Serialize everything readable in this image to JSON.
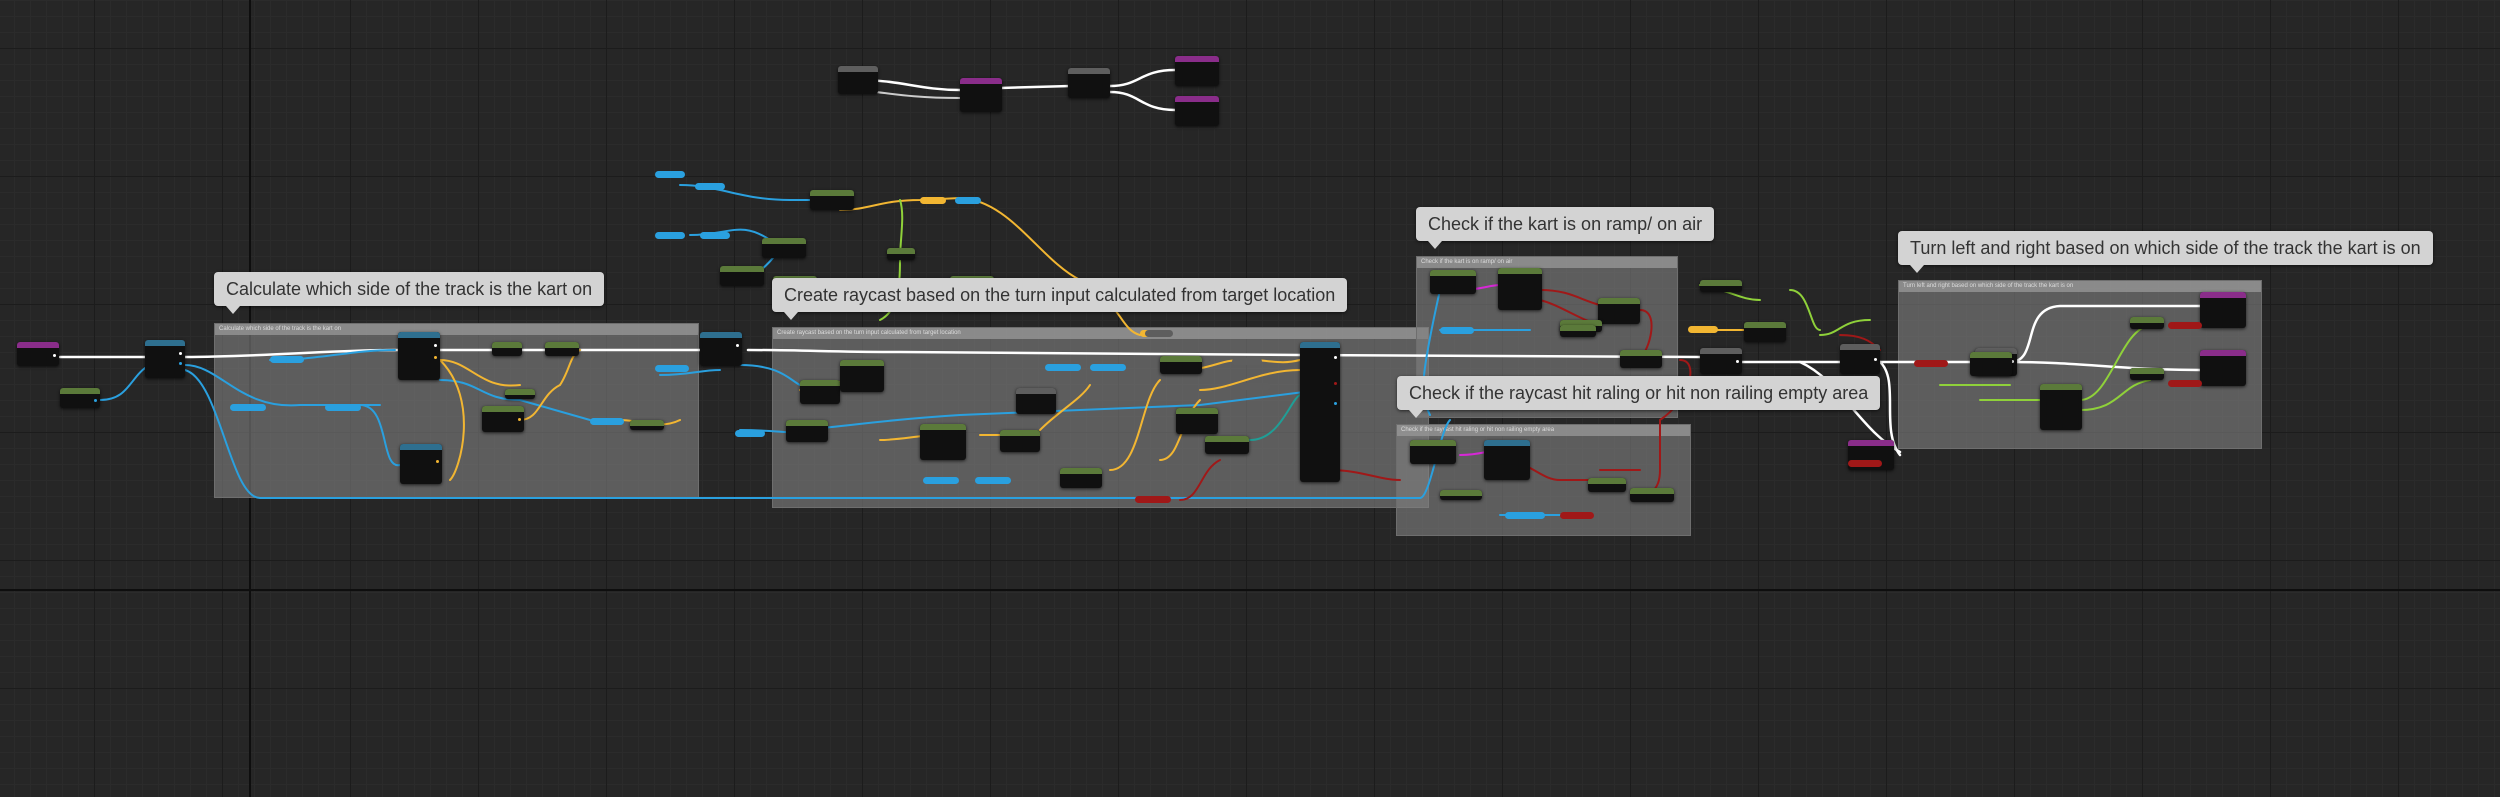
{
  "window": {
    "title": ""
  },
  "comments": [
    {
      "id": "calc-side",
      "bubble": "Calculate which side of  the track is the kart on",
      "header": "Calculate which side of the track is the kart on"
    },
    {
      "id": "raycast",
      "bubble": "Create raycast based on the turn input calculated from target location",
      "header": "Create raycast based on the turn input calculated from target location"
    },
    {
      "id": "ramp-air",
      "bubble": "Check if the kart is on ramp/ on air",
      "header": "Check if the kart is on ramp/ on air"
    },
    {
      "id": "railing",
      "bubble": "Check if the raycast hit raling or hit non railing empty area",
      "header": "Check if the raycast hit raling or hit non railing empty area"
    },
    {
      "id": "turn",
      "bubble": "Turn left and right based on which side of the track the kart is on",
      "header": "Turn left and right based on which side of the track the kart is on"
    }
  ],
  "colors": {
    "background": "#262626",
    "exec_wire": "#ffffff",
    "float_wire": "#f2b632",
    "vector_wire": "#2aa0df",
    "bool_wire": "#a01818",
    "struct_wire": "#8fd13a",
    "teal_wire": "#1f9e96",
    "event_header": "#8a2d8a",
    "pure_header": "#5b7a3a",
    "function_header": "#2e6f8f",
    "flow_header": "#5e5e5e"
  },
  "nodes": [
    {
      "kind": "event"
    },
    {
      "kind": "pure"
    },
    {
      "kind": "function"
    },
    {
      "kind": "function"
    },
    {
      "kind": "pure"
    },
    {
      "kind": "pure"
    },
    {
      "kind": "function"
    },
    {
      "kind": "pure"
    },
    {
      "kind": "pure"
    },
    {
      "kind": "function"
    },
    {
      "kind": "pure"
    },
    {
      "kind": "function"
    },
    {
      "kind": "flow"
    },
    {
      "kind": "event"
    },
    {
      "kind": "flow"
    },
    {
      "kind": "event"
    },
    {
      "kind": "event"
    },
    {
      "kind": "pure"
    },
    {
      "kind": "pure"
    },
    {
      "kind": "pure"
    },
    {
      "kind": "pure"
    },
    {
      "kind": "pure"
    },
    {
      "kind": "pure"
    },
    {
      "kind": "pure"
    },
    {
      "kind": "pure"
    },
    {
      "kind": "pure"
    },
    {
      "kind": "pure"
    },
    {
      "kind": "function"
    },
    {
      "kind": "pure"
    },
    {
      "kind": "pure"
    },
    {
      "kind": "pure"
    },
    {
      "kind": "pure"
    },
    {
      "kind": "pure"
    },
    {
      "kind": "pure"
    },
    {
      "kind": "pure"
    },
    {
      "kind": "pure"
    },
    {
      "kind": "flow"
    },
    {
      "kind": "event"
    },
    {
      "kind": "pure"
    },
    {
      "kind": "pure"
    },
    {
      "kind": "pure"
    },
    {
      "kind": "event"
    },
    {
      "kind": "event"
    },
    {
      "kind": "pure"
    },
    {
      "kind": "pure"
    },
    {
      "kind": "pure"
    },
    {
      "kind": "pure"
    },
    {
      "kind": "pure"
    }
  ]
}
